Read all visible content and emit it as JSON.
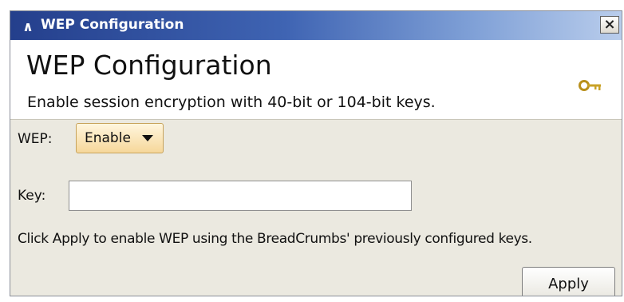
{
  "window": {
    "title": "WEP Configuration",
    "collapse_glyph": "∧",
    "close_glyph": "×"
  },
  "header": {
    "title": "WEP Configuration",
    "subtitle": "Enable session encryption with 40-bit or 104-bit keys.",
    "icon": "key-icon"
  },
  "form": {
    "wep_label": "WEP:",
    "wep_value": "Enable",
    "key_label": "Key:",
    "key_value": "",
    "key_placeholder": "",
    "help_text": "Click Apply to enable WEP using the BreadCrumbs' previously configured keys.",
    "apply_label": "Apply"
  },
  "colors": {
    "titlebar_start": "#243f8c",
    "panel_background": "#ebe9e0",
    "select_background": "#f6d79a",
    "key_icon": "#c9a227"
  }
}
